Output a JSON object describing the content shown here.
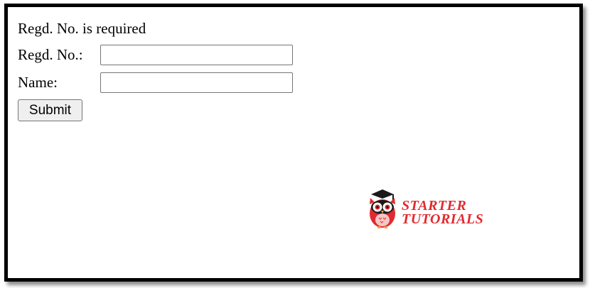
{
  "form": {
    "error_message": "Regd. No. is required",
    "regd_label": "Regd. No.:",
    "regd_value": "",
    "name_label": "Name:",
    "name_value": "",
    "submit_label": "Submit"
  },
  "watermark": {
    "line1": "STARTER",
    "line2": "TUTORIALS",
    "icon": "owl-icon"
  },
  "colors": {
    "frame_border": "#000000",
    "logo_red": "#e12a2f",
    "button_bg": "#efefef"
  }
}
